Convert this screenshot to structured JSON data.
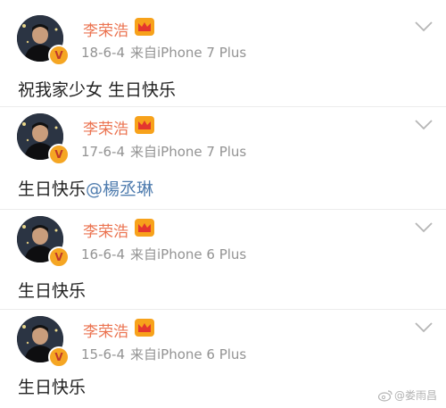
{
  "posts": [
    {
      "username": "李荣浩",
      "date": "18-6-4",
      "source": "来自iPhone 7 Plus",
      "text": "祝我家少女 生日快乐",
      "mention": ""
    },
    {
      "username": "李荣浩",
      "date": "17-6-4",
      "source": "来自iPhone 7 Plus",
      "text": "生日快乐",
      "mention": "@楊丞琳"
    },
    {
      "username": "李荣浩",
      "date": "16-6-4",
      "source": "来自iPhone 6 Plus",
      "text": "生日快乐",
      "mention": ""
    },
    {
      "username": "李荣浩",
      "date": "15-6-4",
      "source": "来自iPhone 6 Plus",
      "text": "生日快乐",
      "mention": ""
    }
  ],
  "icons": {
    "verified": "verified-v-badge",
    "crown": "vip-crown-icon",
    "chevron": "chevron-down-icon"
  },
  "watermark": {
    "text": "@娄雨昌"
  },
  "colors": {
    "username": "#eb7350",
    "meta": "#939393",
    "mention": "#507daf",
    "badge": "#f5a623"
  }
}
